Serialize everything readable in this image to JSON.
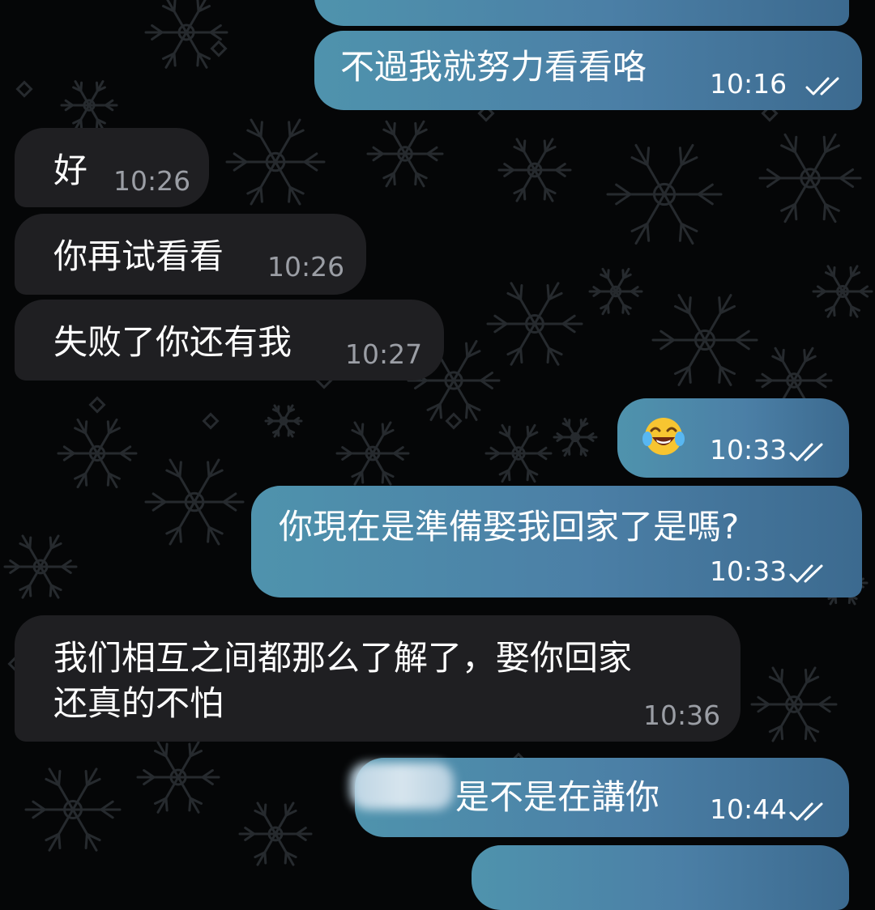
{
  "theme": {
    "incoming_bubble": "#1f1f22",
    "outgoing_bubble": "#4b7fa6",
    "incoming_time": "#9b9ea5",
    "background": "#050607"
  },
  "messages": [
    {
      "text": "不過我就努力看看咯",
      "time": "10:16",
      "direction": "outgoing",
      "read": true
    },
    {
      "text": "好",
      "time": "10:26",
      "direction": "incoming"
    },
    {
      "text": "你再试看看",
      "time": "10:26",
      "direction": "incoming"
    },
    {
      "text": "失败了你还有我",
      "time": "10:27",
      "direction": "incoming"
    },
    {
      "text": "",
      "emoji": "face-with-tears-of-joy",
      "time": "10:33",
      "direction": "outgoing",
      "read": true
    },
    {
      "text": "你現在是準備娶我回家了是嗎?",
      "time": "10:33",
      "direction": "outgoing",
      "read": true
    },
    {
      "line1": "我们相互之间都那么了解了，娶你回家",
      "line2": "还真的不怕",
      "time": "10:36",
      "direction": "incoming"
    },
    {
      "text": "是不是在講你",
      "time": "10:44",
      "direction": "outgoing",
      "read": true,
      "redacted_prefix": true
    }
  ]
}
